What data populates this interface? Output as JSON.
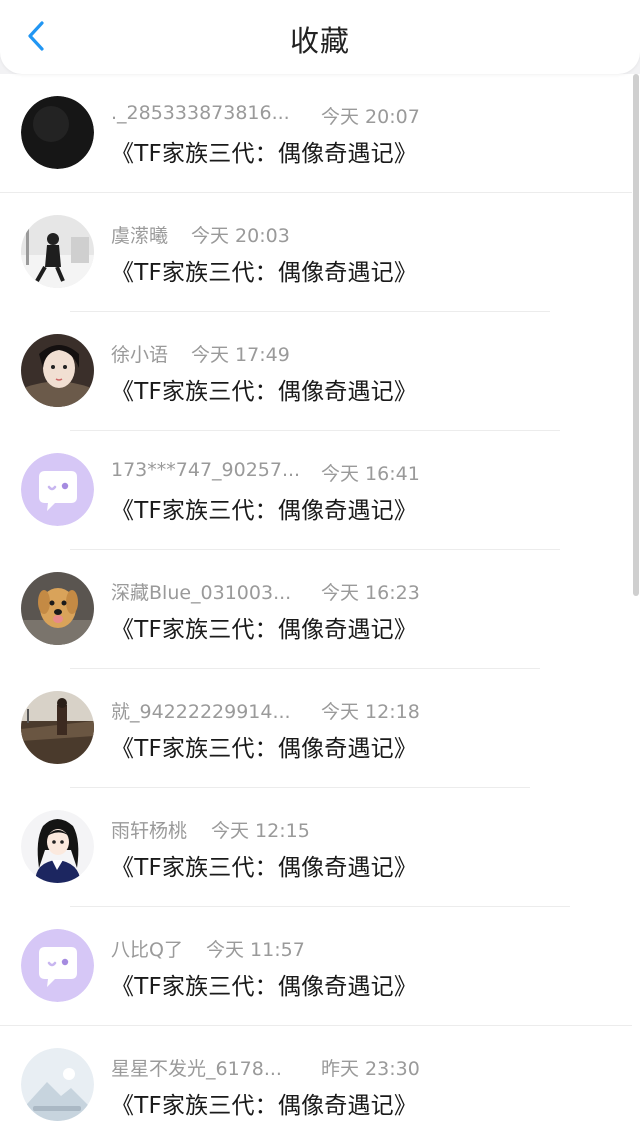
{
  "header": {
    "title": "收藏",
    "back_icon": "chevron-left-icon",
    "accent_color": "#2196f3"
  },
  "items": [
    {
      "name": "._285333873816...",
      "time": "今天 20:07",
      "title": "《TF家族三代：偶像奇遇记》",
      "avatar": "black-photo"
    },
    {
      "name": "虞潆曦",
      "time": "今天 20:03",
      "title": "《TF家族三代：偶像奇遇记》",
      "avatar": "person-snow-photo"
    },
    {
      "name": "徐小语",
      "time": "今天 17:49",
      "title": "《TF家族三代：偶像奇遇记》",
      "avatar": "girl-portrait-photo"
    },
    {
      "name": "173***747_90257...",
      "time": "今天 16:41",
      "title": "《TF家族三代：偶像奇遇记》",
      "avatar": "default-chat-avatar"
    },
    {
      "name": "深藏Blue_031003...",
      "time": "今天 16:23",
      "title": "《TF家族三代：偶像奇遇记》",
      "avatar": "puppy-photo"
    },
    {
      "name": "就_94222229914...",
      "time": "今天 12:18",
      "title": "《TF家族三代：偶像奇遇记》",
      "avatar": "landscape-person-photo"
    },
    {
      "name": "雨轩杨桃",
      "time": "今天 12:15",
      "title": "《TF家族三代：偶像奇遇记》",
      "avatar": "anime-girl-illustration"
    },
    {
      "name": "八比Q了",
      "time": "今天 11:57",
      "title": "《TF家族三代：偶像奇遇记》",
      "avatar": "default-chat-avatar"
    },
    {
      "name": "星星不发光_6178...",
      "time": "昨天 23:30",
      "title": "《TF家族三代：偶像奇遇记》",
      "avatar": "placeholder-image"
    }
  ]
}
